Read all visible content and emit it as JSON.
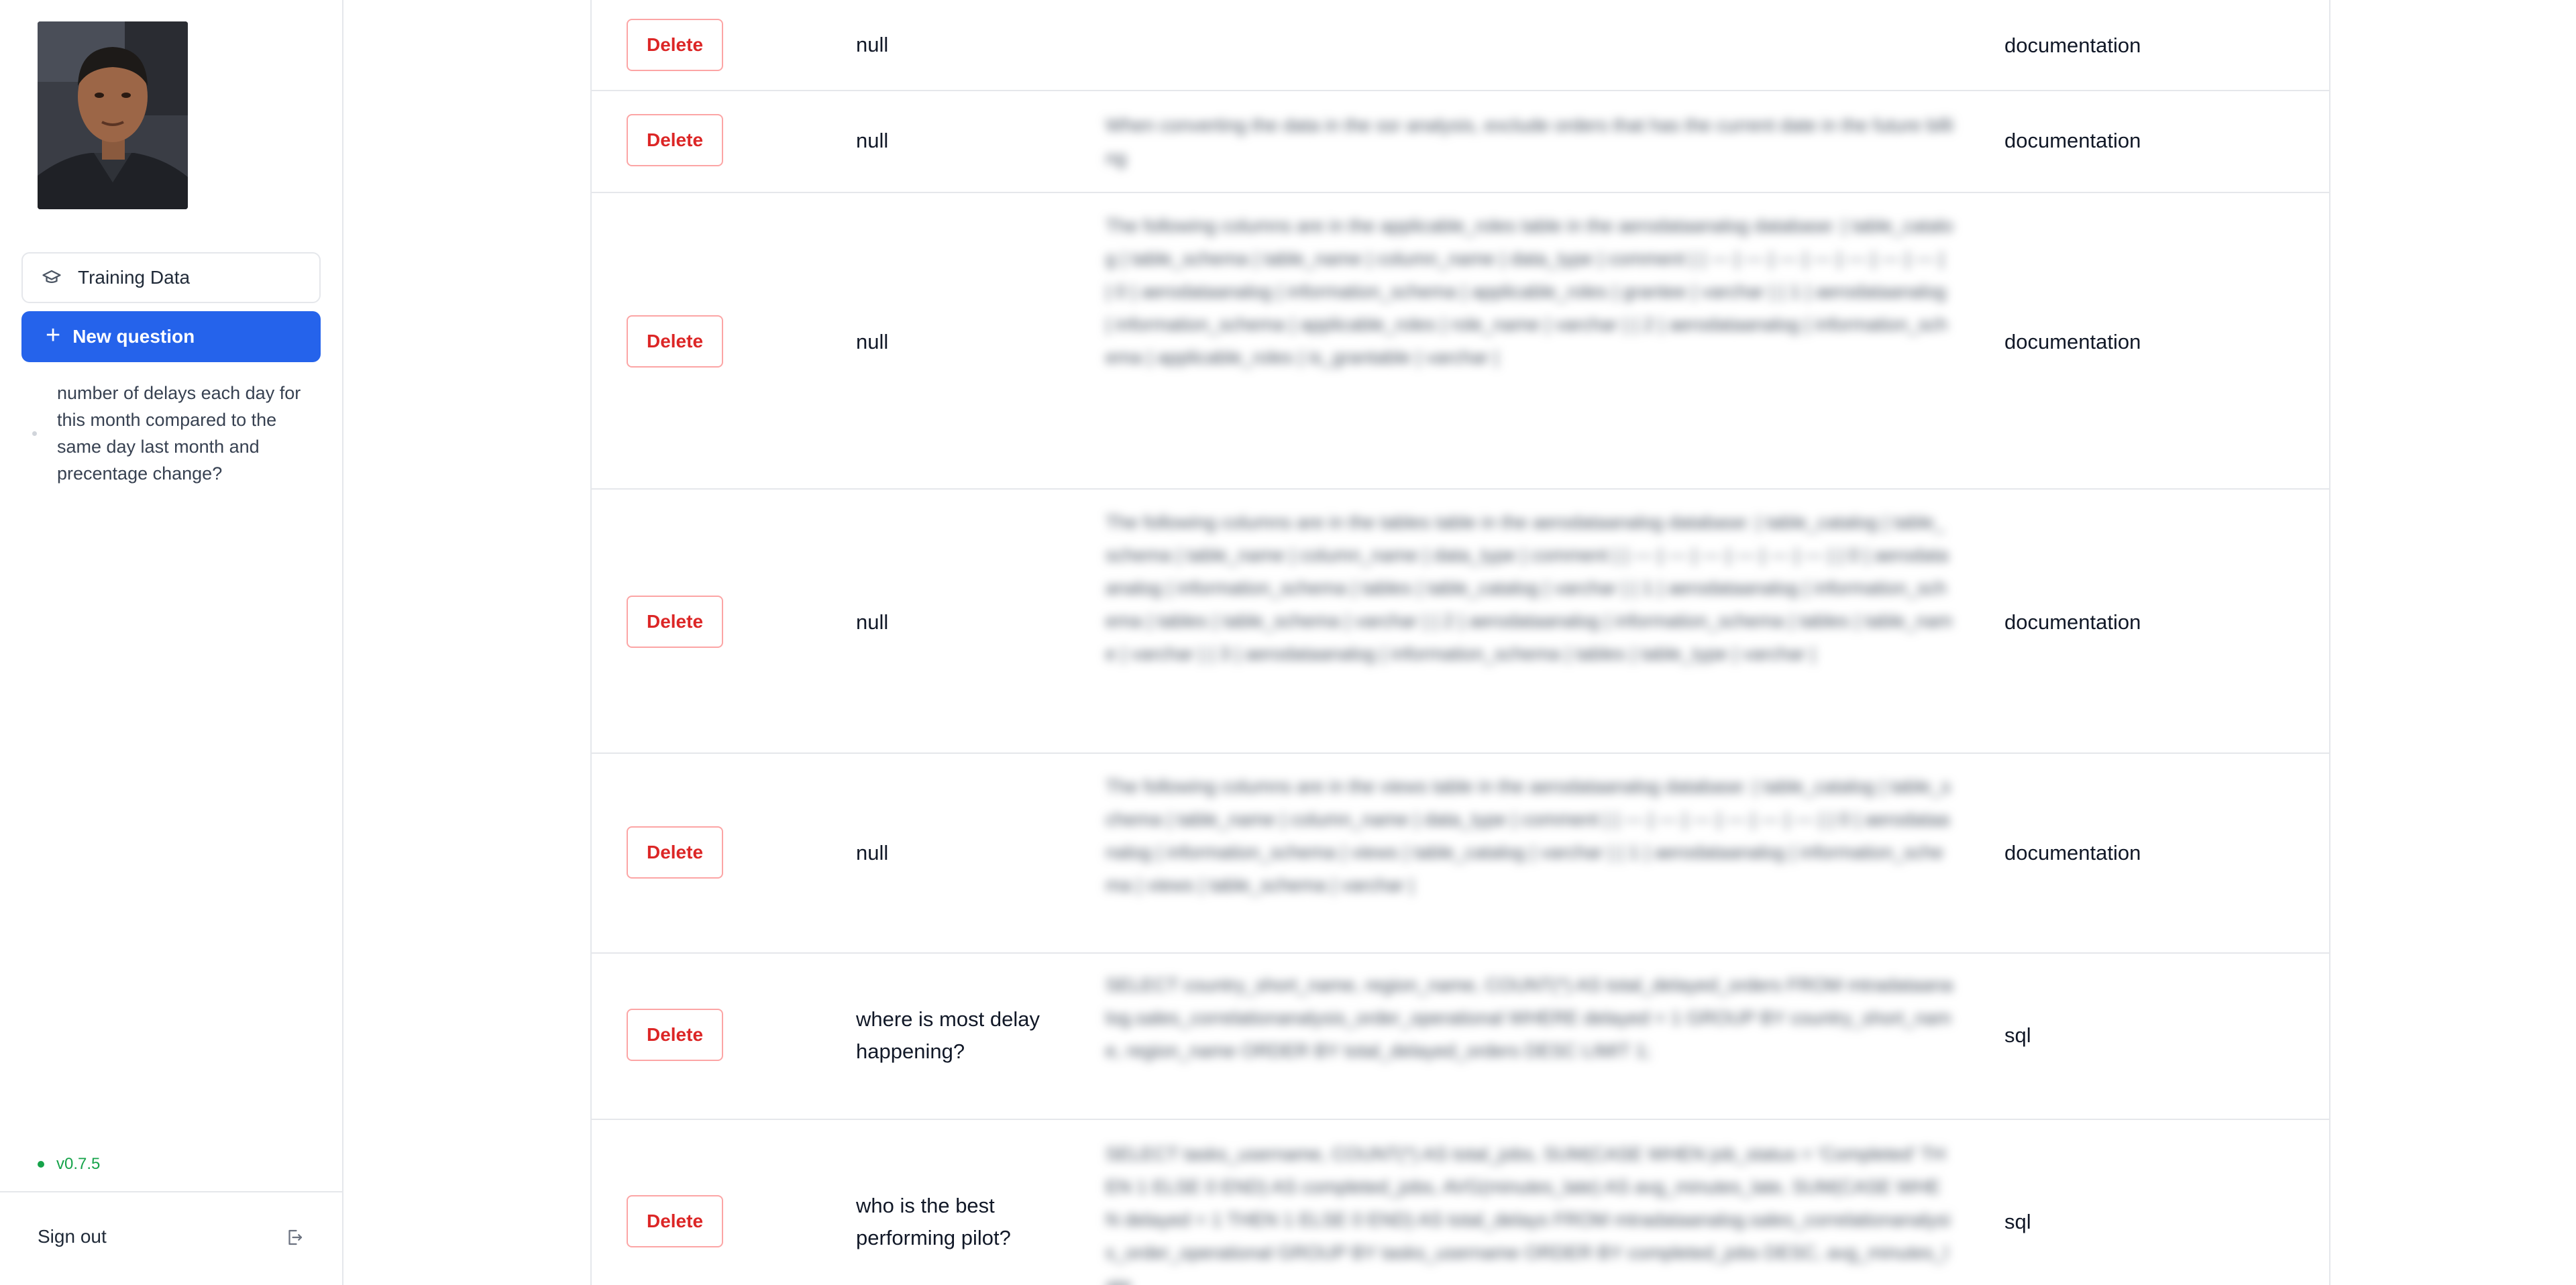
{
  "sidebar": {
    "training_label": "Training Data",
    "new_question_label": "New question",
    "history": [
      "number of delays each day for this month compared to the same day last month and precentage change?"
    ],
    "version": "v0.7.5",
    "sign_out_label": "Sign out"
  },
  "table": {
    "rows": [
      {
        "action": "Delete",
        "question": "null",
        "content": "",
        "type": "documentation"
      },
      {
        "action": "Delete",
        "question": "null",
        "content": "When converting the data in the ssr analysis, exclude orders that has the current date in the future billing",
        "type": "documentation"
      },
      {
        "action": "Delete",
        "question": "null",
        "content": "The following columns are in the applicable_roles table in the aerodataanalog database: | table_catalog | table_schema | table_name | column_name | data_type | comment | | --- | --- | --- | --- | --- | --- | --- | | 0 | aerodataanalog | information_schema | applicable_roles | grantee | varchar | | 1 | aerodataanalog | information_schema | applicable_roles | role_name | varchar | | 2 | aerodataanalog | information_schema | applicable_roles | is_grantable | varchar |",
        "type": "documentation"
      },
      {
        "action": "Delete",
        "question": "null",
        "content": "The following columns are in the tables table in the aerodataanalog database: | table_catalog | table_schema | table_name | column_name | data_type | comment | | --- | --- | --- | --- | --- | --- | | 0 | aerodataanalog | information_schema | tables | table_catalog | varchar | | 1 | aerodataanalog | information_schema | tables | table_schema | varchar | | 2 | aerodataanalog | information_schema | tables | table_name | varchar | | 3 | aerodataanalog | information_schema | tables | table_type | varchar |",
        "type": "documentation"
      },
      {
        "action": "Delete",
        "question": "null",
        "content": "The following columns are in the views table in the aerodataanalog database: | table_catalog | table_schema | table_name | column_name | data_type | comment | | --- | --- | --- | --- | --- | --- | | 0 | aerodataanalog | information_schema | views | table_catalog | varchar | | 1 | aerodataanalog | information_schema | views | table_schema | varchar |",
        "type": "documentation"
      },
      {
        "action": "Delete",
        "question": "where is most delay happening?",
        "content": "SELECT country_short_name, region_name, COUNT(*) AS total_delayed_orders FROM mtradataanalog.sales_correlationanalysis_order_operational WHERE delayed = 1 GROUP BY country_short_name, region_name ORDER BY total_delayed_orders DESC LIMIT 1;",
        "type": "sql"
      },
      {
        "action": "Delete",
        "question": "who is the best performing pilot?",
        "content": "SELECT tasks_username, COUNT(*) AS total_jobs, SUM(CASE WHEN job_status = 'Completed' THEN 1 ELSE 0 END) AS completed_jobs, AVG(minutes_late) AS avg_minutes_late, SUM(CASE WHEN delayed = 1 THEN 1 ELSE 0 END) AS total_delays FROM mtradataanalog.sales_correlationanalysis_order_operational GROUP BY tasks_username ORDER BY completed_jobs DESC, avg_minutes_late",
        "type": "sql"
      }
    ]
  }
}
